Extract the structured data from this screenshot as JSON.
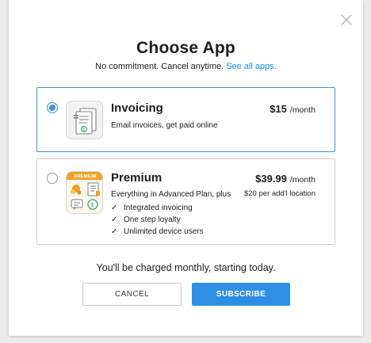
{
  "dialog": {
    "title": "Choose App",
    "subtitle": "No commitment. Cancel anytime.",
    "see_all_link": "See all apps."
  },
  "plans": [
    {
      "name": "Invoicing",
      "description": "Email invoices, get paid online",
      "price": "$15",
      "period": "/month",
      "selected": true,
      "icon": "invoice-document-icon"
    },
    {
      "name": "Premium",
      "badge": "PREMIUM",
      "description": "Everything in Advanced Plan, plus",
      "features": [
        "Integrated invoicing",
        "One step loyalty",
        "Unlimited device users"
      ],
      "price": "$39.99",
      "period": "/month",
      "additional": "$20 per add'l location",
      "selected": false,
      "icon": "premium-bundle-icon"
    }
  ],
  "footer": {
    "charge_note": "You'll be charged monthly, starting today.",
    "cancel_label": "CANCEL",
    "subscribe_label": "SUBSCRIBE"
  },
  "colors": {
    "accent": "#2f8fe4",
    "link": "#1a8de0",
    "premium_badge": "#f0a024"
  }
}
